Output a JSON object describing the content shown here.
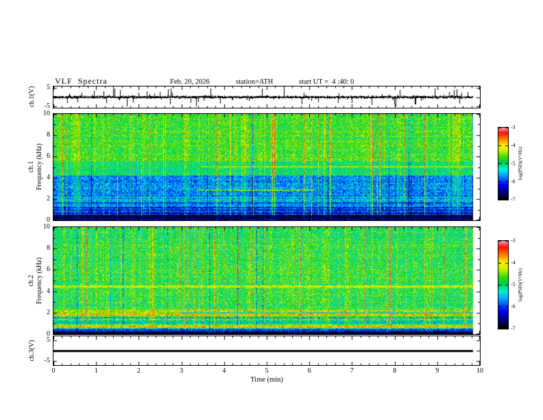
{
  "title": "VLF  Spectra",
  "header": {
    "date": "Feb. 20, 2026",
    "station": "station=ATH",
    "start_ut": "start UT =  4 :40: 0"
  },
  "xaxis": {
    "label": "Time (min)",
    "range_min": [
      0,
      10
    ],
    "ticks": [
      0,
      1,
      2,
      3,
      4,
      5,
      6,
      7,
      8,
      9,
      10
    ],
    "data_end_min": 9.84
  },
  "colorbars": [
    {
      "label": "log(PSD)(V²/Hz)",
      "range": [
        -7,
        -3
      ],
      "ticks": [
        -3,
        -4,
        -5,
        -6,
        -7
      ]
    },
    {
      "label": "log(PSD)(V²/Hz)",
      "range": [
        -7,
        -3
      ],
      "ticks": [
        -3,
        -4,
        -5,
        -6,
        -7
      ]
    }
  ],
  "colors": {
    "background": "#ffffff",
    "axis": "#000000",
    "colormap_stops": [
      [
        0.0,
        "#000000"
      ],
      [
        0.08,
        "#000066"
      ],
      [
        0.2,
        "#0000ee"
      ],
      [
        0.33,
        "#0099ff"
      ],
      [
        0.42,
        "#00eedd"
      ],
      [
        0.52,
        "#00cc44"
      ],
      [
        0.6,
        "#44dd00"
      ],
      [
        0.68,
        "#ccee00"
      ],
      [
        0.76,
        "#ffee00"
      ],
      [
        0.85,
        "#ff7700"
      ],
      [
        0.93,
        "#ff1100"
      ],
      [
        1.0,
        "#ff99aa"
      ]
    ]
  },
  "chart_data": [
    {
      "id": "ch1-waveform",
      "type": "line",
      "ylabel": "ch.1(V)",
      "ylim": [
        -5,
        5
      ],
      "yticks": [
        5,
        -5
      ],
      "x_range_min": [
        0,
        9.84
      ],
      "signal": {
        "kind": "continuous broadband noise around 0 V with dense impulsive spikes reaching about ±5 V",
        "baseline_v": 0
      }
    },
    {
      "id": "ch1-spectrogram",
      "type": "heatmap",
      "channel_label": "ch.1",
      "ylabel": "Frequency (kHz)",
      "ylim": [
        0,
        10
      ],
      "yticks": [
        0,
        2,
        4,
        6,
        8,
        10
      ],
      "zlabel": "log(PSD)(V²/Hz)",
      "zlim": [
        -7,
        -3
      ],
      "bands": [
        {
          "f_khz": [
            5.5,
            10.0
          ],
          "log_psd": -4.75,
          "appearance": "green"
        },
        {
          "f_khz": [
            4.2,
            5.5
          ],
          "log_psd": -5.05,
          "appearance": "green-cyan"
        },
        {
          "f_khz": [
            1.2,
            4.2
          ],
          "log_psd": -5.75,
          "appearance": "blue"
        },
        {
          "f_khz": [
            0.5,
            1.2
          ],
          "log_psd": -6.15,
          "appearance": "dark blue, horizontally striped"
        },
        {
          "f_khz": [
            0.0,
            0.5
          ],
          "log_psd": -6.85,
          "appearance": "black"
        }
      ],
      "lines": [
        {
          "f_khz": 5.05,
          "log_psd": -4.3,
          "t_frac": [
            0.35,
            1.0
          ]
        },
        {
          "f_khz": 2.85,
          "log_psd": -4.4,
          "t_frac": [
            0.34,
            0.62
          ]
        }
      ],
      "texture": {
        "noise_log": 0.5,
        "streaks": "dense vertical broadband bursts (yellow-red) across all frequencies"
      }
    },
    {
      "id": "ch2-spectrogram",
      "type": "heatmap",
      "channel_label": "ch.2",
      "ylabel": "Frequency (kHz)",
      "ylim": [
        0,
        10
      ],
      "yticks": [
        0,
        2,
        4,
        6,
        8,
        10
      ],
      "zlabel": "log(PSD)(V²/Hz)",
      "zlim": [
        -7,
        -3
      ],
      "bands": [
        {
          "f_khz": [
            2.3,
            10.0
          ],
          "log_psd": -4.9,
          "appearance": "green with cyan speckle"
        },
        {
          "f_khz": [
            1.6,
            2.3
          ],
          "log_psd": -4.4,
          "appearance": "yellow-green band"
        },
        {
          "f_khz": [
            0.95,
            1.6
          ],
          "log_psd": -5.1,
          "appearance": "green"
        },
        {
          "f_khz": [
            0.55,
            0.95
          ],
          "log_psd": -4.5,
          "appearance": "yellow striped"
        },
        {
          "f_khz": [
            0.3,
            0.55
          ],
          "log_psd": -5.9,
          "appearance": "dark striped"
        },
        {
          "f_khz": [
            0.0,
            0.3
          ],
          "log_psd": -6.7,
          "appearance": "black"
        }
      ],
      "lines": [
        {
          "f_khz": 4.45,
          "log_psd": -4.15,
          "t_frac": [
            0.0,
            1.0
          ]
        },
        {
          "f_khz": 2.0,
          "log_psd": -5.5,
          "t_frac": [
            0.3,
            1.0
          ]
        }
      ],
      "texture": {
        "noise_log": 0.6,
        "streaks": "dense vertical broadband bursts, yellow-red, with occasional dark dropout columns"
      }
    },
    {
      "id": "ch3-waveform",
      "type": "line",
      "ylabel": "ch.3(V)",
      "ylim": [
        -5,
        5
      ],
      "yticks": [
        5,
        -5
      ],
      "x_range_min": [
        0,
        9.84
      ],
      "signal": {
        "kind": "flat thick line at 0 V (no signal)",
        "baseline_v": 0
      }
    }
  ]
}
